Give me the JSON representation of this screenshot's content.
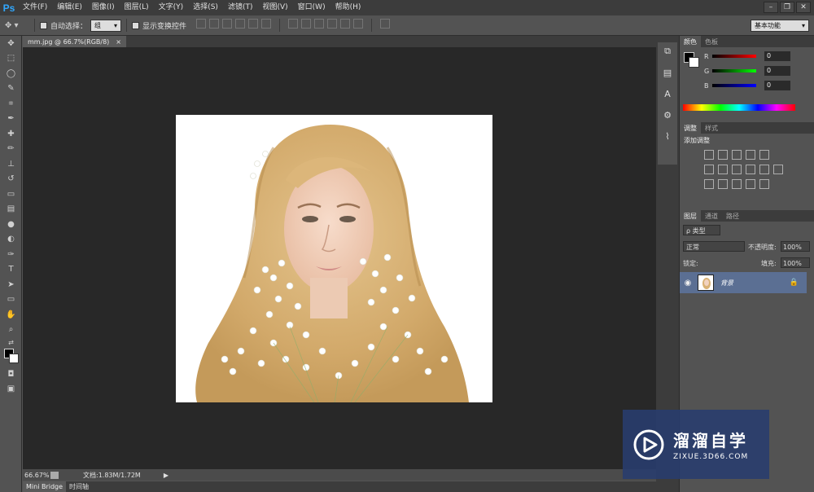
{
  "app": {
    "logo": "Ps"
  },
  "menu": [
    "文件(F)",
    "编辑(E)",
    "图像(I)",
    "图层(L)",
    "文字(Y)",
    "选择(S)",
    "滤镜(T)",
    "视图(V)",
    "窗口(W)",
    "帮助(H)"
  ],
  "options": {
    "auto_select_label": "自动选择：",
    "auto_select_value": "组",
    "show_transform_label": "显示变换控件",
    "workspace": "基本功能"
  },
  "document": {
    "tab_title": "mm.jpg @ 66.7%(RGB/8)",
    "tab_close": "×",
    "zoom": "66.67%",
    "doc_info": "文档:1.83M/1.72M"
  },
  "bottom_tabs": [
    "Mini Bridge",
    "时间轴"
  ],
  "color_panel": {
    "tabs": [
      "颜色",
      "色板"
    ],
    "sliders": [
      {
        "label": "R",
        "value": "0",
        "color": "#ff0000"
      },
      {
        "label": "G",
        "value": "0",
        "color": "#00ff00"
      },
      {
        "label": "B",
        "value": "0",
        "color": "#0000ff"
      }
    ]
  },
  "adjust_panel": {
    "tabs": [
      "调整",
      "样式"
    ],
    "title": "添加调整"
  },
  "layers_panel": {
    "tabs": [
      "图层",
      "通道",
      "路径"
    ],
    "filter": "ρ 类型",
    "blend_mode": "正常",
    "opacity_label": "不透明度:",
    "opacity": "100%",
    "lock_label": "锁定:",
    "fill_label": "填充:",
    "fill": "100%",
    "layer_name": "背景"
  },
  "watermark": {
    "cn": "溜溜自学",
    "en": "ZIXUE.3D66.COM"
  },
  "colors": {
    "accent": "#31a8ff",
    "selected_layer": "#5b6f93",
    "canvas_bg": "#282828"
  }
}
